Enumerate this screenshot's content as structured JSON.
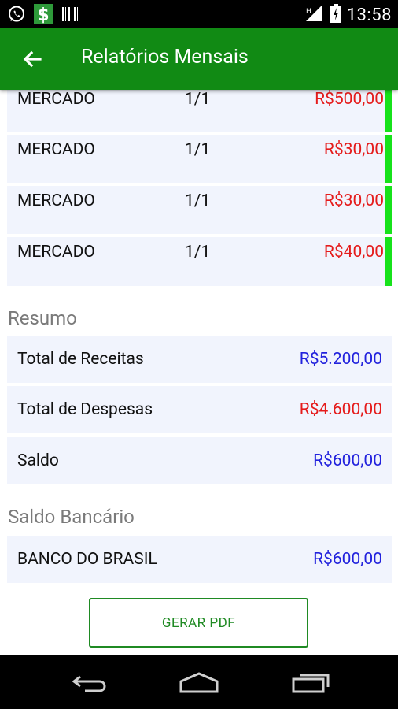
{
  "status_bar": {
    "time": "13:58",
    "icons": [
      "whatsapp-icon",
      "dollar-app-icon",
      "barcode-icon",
      "signal-icon",
      "battery-icon"
    ]
  },
  "app_bar": {
    "title": "Relatórios Mensais",
    "back_icon": "arrow-back-icon"
  },
  "expenses": [
    {
      "name": "MERCADO",
      "installment": "1/1",
      "value": "R$500,00"
    },
    {
      "name": "MERCADO",
      "installment": "1/1",
      "value": "R$30,00"
    },
    {
      "name": "MERCADO",
      "installment": "1/1",
      "value": "R$30,00"
    },
    {
      "name": "MERCADO",
      "installment": "1/1",
      "value": "R$40,00"
    }
  ],
  "summary": {
    "title": "Resumo",
    "rows": [
      {
        "label": "Total de Receitas",
        "value": "R$5.200,00"
      },
      {
        "label": "Total de Despesas",
        "value": "R$4.600,00"
      },
      {
        "label": "Saldo",
        "value": "R$600,00"
      }
    ]
  },
  "bank": {
    "title": "Saldo Bancário",
    "rows": [
      {
        "label": "BANCO DO BRASIL",
        "value": "R$600,00"
      }
    ]
  },
  "buttons": {
    "generate_pdf": "GERAR PDF"
  },
  "colors": {
    "app_bar": "#118a14",
    "income": "#2222dd",
    "expense": "#e51b1b",
    "indicator": "#17e21b"
  },
  "nav_bar": [
    "back-nav-icon",
    "home-nav-icon",
    "recents-nav-icon"
  ]
}
